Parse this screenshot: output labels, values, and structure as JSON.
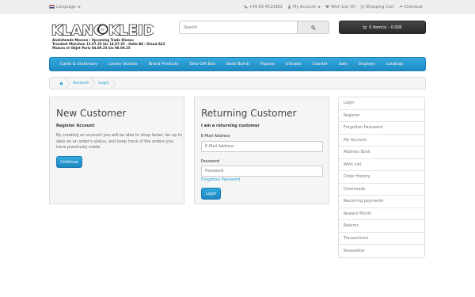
{
  "topbar": {
    "language_label": "Language",
    "links": [
      {
        "icon": "phone-icon",
        "label": "+49 89 4510883"
      },
      {
        "icon": "user-icon",
        "label": "My Account"
      },
      {
        "icon": "heart-icon",
        "label": "Wish List (0)"
      },
      {
        "icon": "cart-icon",
        "label": "Shopping Cart"
      },
      {
        "icon": "share-icon",
        "label": "Checkout"
      }
    ]
  },
  "header": {
    "logo_text": "KLANGKLEID",
    "trade_lines": [
      "Anstehende Messen / Upcoming Trade Shows:",
      "Trendset München 12.07.25 bis 14.07.25 - Halle B6 / Stand A32",
      "Maison et Objet Paris 04.09.25 bis 08.09.25"
    ],
    "search_placeholder": "Search",
    "cart_label": "0 item(s) - 0.00€"
  },
  "nav": {
    "items": [
      "Cards & Stationary",
      "Lovely Studios",
      "Brand Products",
      "Elite Gift Box",
      "Bade Bomb",
      "Papaya",
      "UStudio",
      "Coaster",
      "Sale",
      "Displays",
      "Catalogs"
    ]
  },
  "breadcrumb": {
    "items": [
      "Account",
      "Login"
    ]
  },
  "new_customer": {
    "title": "New Customer",
    "subtitle": "Register Account",
    "text": "By creating an account you will be able to shop faster, be up to date on an order's status, and keep track of the orders you have previously made.",
    "button": "Continue"
  },
  "returning_customer": {
    "title": "Returning Customer",
    "subtitle": "I am a returning customer",
    "email_label": "E-Mail Address",
    "email_placeholder": "E-Mail Address",
    "password_label": "Password",
    "password_placeholder": "Password",
    "forgotten_link": "Forgotten Password",
    "button": "Login"
  },
  "account_menu": {
    "items": [
      "Login",
      "Register",
      "Forgotten Password",
      "My Account",
      "Address Book",
      "Wish List",
      "Order History",
      "Downloads",
      "Recurring payments",
      "Reward Points",
      "Returns",
      "Transactions",
      "Newsletter"
    ]
  },
  "colors": {
    "nav_blue": "#2a9fd6",
    "link_blue": "#23a1d1",
    "cart_dark": "#333333"
  }
}
